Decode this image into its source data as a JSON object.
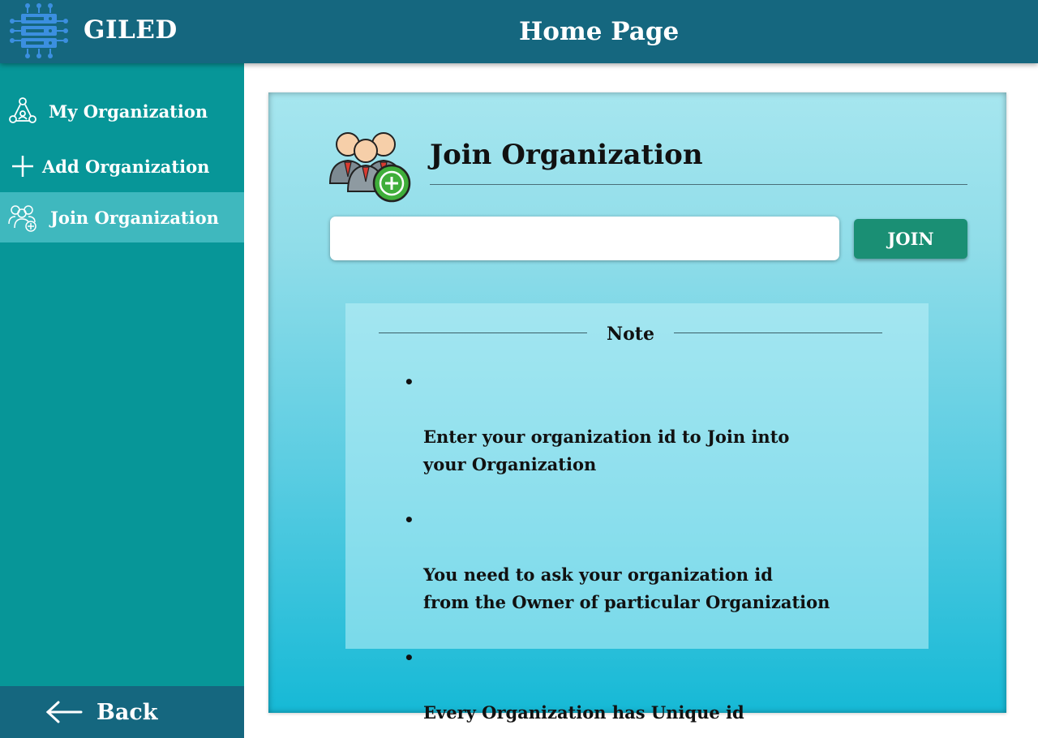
{
  "header": {
    "app_name": "GILED",
    "page_title": "Home Page",
    "background": "#15677f"
  },
  "sidebar": {
    "background": "#079698",
    "active_background": "#3fb8be",
    "items": [
      {
        "label": "My Organization",
        "icon": "organization-network-icon"
      },
      {
        "label": "Add Organization",
        "icon": "plus-icon"
      },
      {
        "label": "Join Organization",
        "icon": "join-group-icon",
        "active": true
      }
    ],
    "back": {
      "label": "Back",
      "icon": "arrow-left-icon"
    }
  },
  "main": {
    "title": "Join Organization",
    "icon": "group-add-icon",
    "input": {
      "value": "",
      "placeholder": ""
    },
    "join_button": "JOIN",
    "note": {
      "title": "Note",
      "bullet": "•",
      "items": [
        "Enter your organization id to Join into\n your Organization",
        "You need to ask your organization id\nfrom the Owner of particular Organization",
        "Every Organization has Unique id"
      ]
    }
  },
  "colors": {
    "button": "#1a8f74",
    "panel_top": "#a6e6ef",
    "panel_bottom": "#16b9d6"
  }
}
